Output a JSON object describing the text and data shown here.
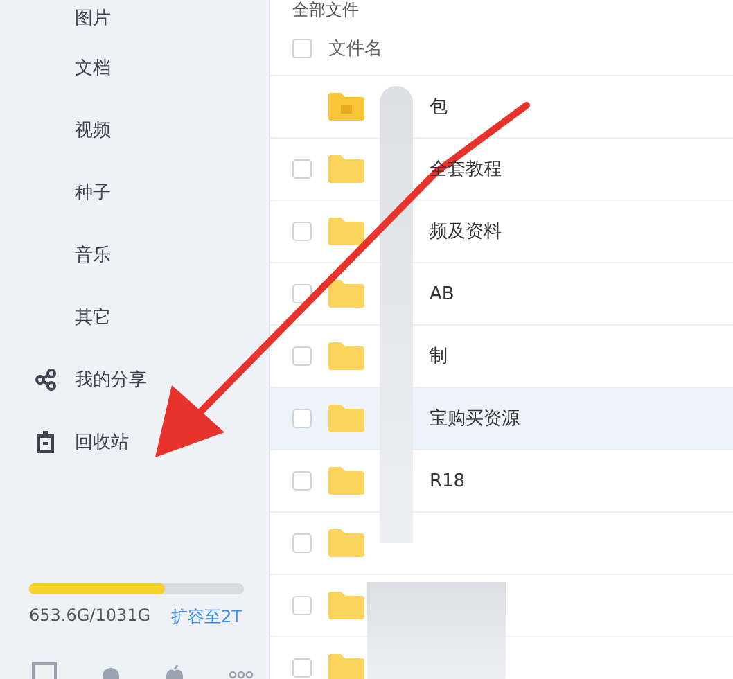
{
  "sidebar": {
    "items": [
      {
        "label": "图片",
        "kind": "category"
      },
      {
        "label": "文档",
        "kind": "category"
      },
      {
        "label": "视频",
        "kind": "category"
      },
      {
        "label": "种子",
        "kind": "category"
      },
      {
        "label": "音乐",
        "kind": "category"
      },
      {
        "label": "其它",
        "kind": "category"
      },
      {
        "label": "我的分享",
        "kind": "share"
      },
      {
        "label": "回收站",
        "kind": "trash"
      }
    ],
    "storage": {
      "level": 0.634,
      "text": "653.6G/1031G",
      "upgrade": "扩容至2T"
    }
  },
  "breadcrumb": "全部文件",
  "table": {
    "header": "文件名",
    "all_checked": false,
    "rows": [
      {
        "name": "包",
        "kind": "special",
        "highlighted": false
      },
      {
        "name": "全套教程",
        "kind": "folder",
        "checked": false,
        "highlighted": false
      },
      {
        "name": "频及资料",
        "kind": "folder",
        "checked": false,
        "highlighted": false
      },
      {
        "name": "AB",
        "kind": "folder",
        "checked": false,
        "highlighted": false
      },
      {
        "name": "制",
        "kind": "folder",
        "checked": false,
        "highlighted": false
      },
      {
        "name": "宝购买资源",
        "kind": "folder",
        "checked": false,
        "highlighted": true
      },
      {
        "name": "R18",
        "kind": "folder",
        "checked": false,
        "highlighted": false
      },
      {
        "kind": "folder",
        "checked": false,
        "highlighted": false
      },
      {
        "kind": "folder",
        "checked": false,
        "highlighted": false
      },
      {
        "kind": "folder",
        "checked": false,
        "highlighted": false
      }
    ]
  }
}
